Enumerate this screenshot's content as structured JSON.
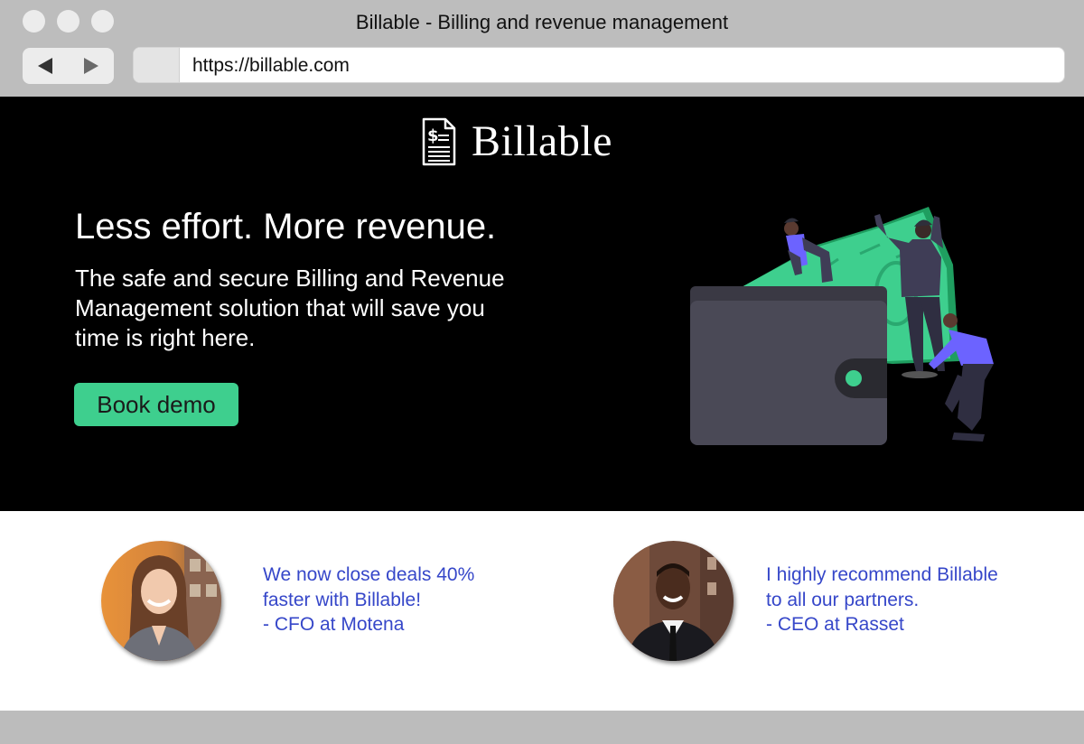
{
  "browser": {
    "window_title": "Billable - Billing and revenue management",
    "url": "https://billable.com"
  },
  "hero": {
    "brand": "Billable",
    "headline": "Less effort. More revenue.",
    "subhead": "The safe and secure Billing and Revenue Management solution that will save you time is right here.",
    "cta_label": "Book demo"
  },
  "testimonials": [
    {
      "lines": [
        "We now close deals 40%",
        "faster with Billable!",
        "- CFO at Motena"
      ]
    },
    {
      "lines": [
        "I highly recommend Billable",
        "to all our partners.",
        "- CEO at Rasset"
      ]
    }
  ],
  "colors": {
    "accent": "#3ecf8e",
    "quote_text": "#3647c9",
    "hero_bg": "#000000",
    "wallet": "#4a4956",
    "person_shirt": "#6c63ff"
  }
}
